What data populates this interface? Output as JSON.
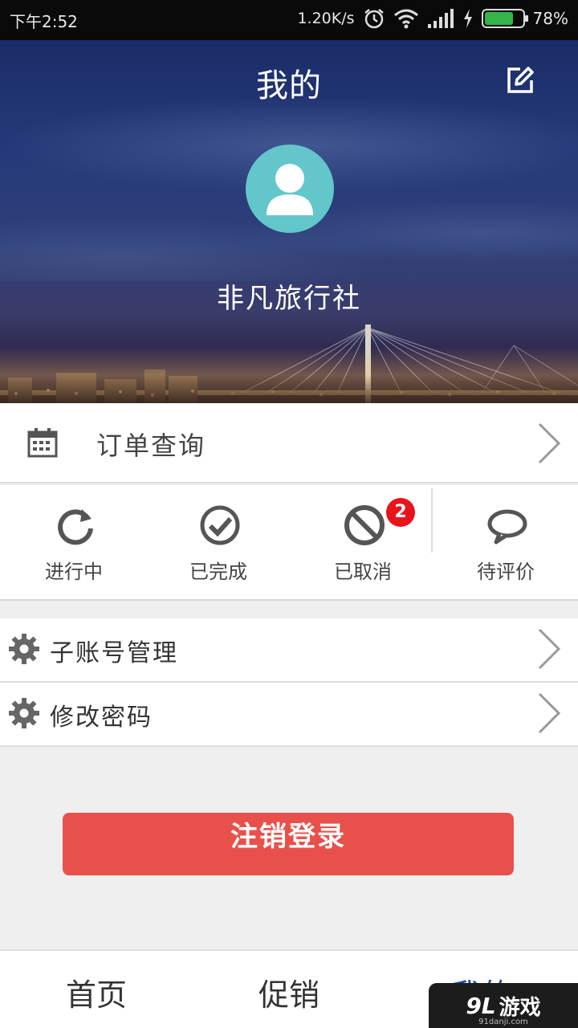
{
  "status_bar": {
    "time": "下午2:52",
    "net_speed": "1.20K/s",
    "battery": "78%",
    "battery_level": 0.78
  },
  "header": {
    "title": "我的",
    "username": "非凡旅行社"
  },
  "order_query": {
    "label": "订单查询"
  },
  "order_status": {
    "tabs": [
      {
        "label": "进行中",
        "icon": "refresh-icon"
      },
      {
        "label": "已完成",
        "icon": "check-circle-icon"
      },
      {
        "label": "已取消",
        "icon": "ban-icon",
        "badge": "2"
      },
      {
        "label": "待评价",
        "icon": "comment-icon"
      }
    ]
  },
  "settings": {
    "items": [
      {
        "label": "子账号管理",
        "icon": "gear-icon"
      },
      {
        "label": "修改密码",
        "icon": "gear-icon"
      }
    ]
  },
  "logout": {
    "label": "注销登录",
    "color": "#e8514b"
  },
  "bottom_nav": {
    "items": [
      {
        "label": "首页"
      },
      {
        "label": "促销"
      },
      {
        "label": "我的",
        "active": true
      }
    ],
    "active_color": "#1e4ea8"
  },
  "watermark": {
    "logo": "9L",
    "text": "游戏",
    "url": "91danji.com"
  }
}
